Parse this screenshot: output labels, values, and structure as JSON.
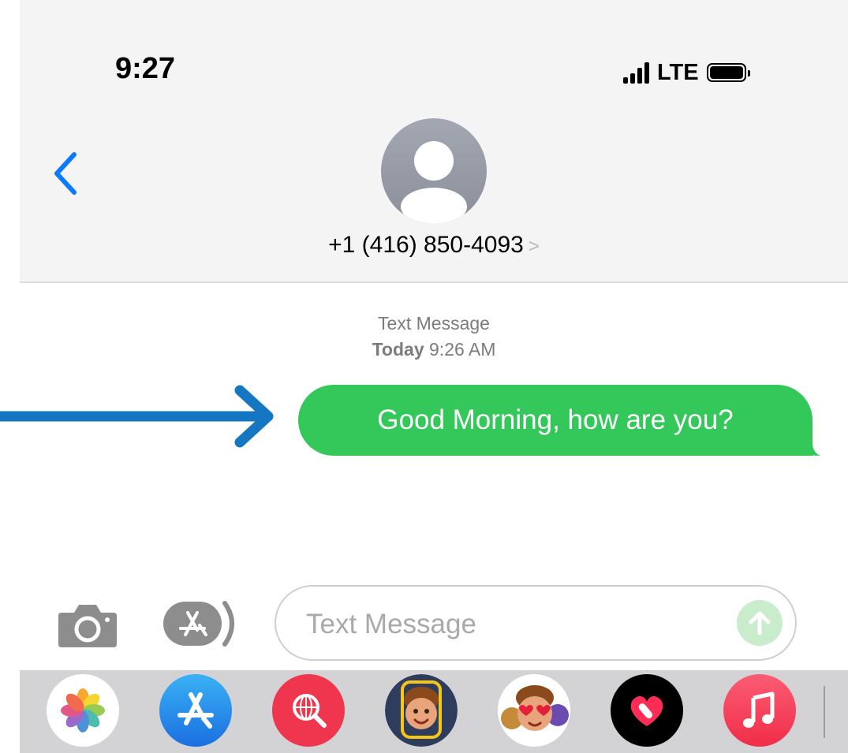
{
  "status_bar": {
    "time": "9:27",
    "network": "LTE"
  },
  "contact": {
    "name": "+1 (416) 850-4093",
    "chevron": ">"
  },
  "thread": {
    "service_label": "Text Message",
    "date_day": "Today",
    "date_time": "9:26 AM"
  },
  "messages": [
    {
      "direction": "outgoing",
      "text": "Good Morning, how are you?",
      "color": "#34c759"
    }
  ],
  "compose": {
    "placeholder": "Text Message",
    "value": ""
  },
  "app_drawer": {
    "apps": [
      {
        "name": "photos-app",
        "icon": "photos-flower-icon"
      },
      {
        "name": "app-store-app",
        "icon": "app-store-icon"
      },
      {
        "name": "images-search-app",
        "icon": "globe-search-icon"
      },
      {
        "name": "memoji-stickers-app",
        "icon": "memoji-icon"
      },
      {
        "name": "animoji-app",
        "icon": "animoji-heart-eyes-icon"
      },
      {
        "name": "digital-touch-app",
        "icon": "heart-touch-icon"
      },
      {
        "name": "music-app",
        "icon": "music-note-icon"
      }
    ]
  },
  "colors": {
    "accent_blue": "#0a7aff",
    "bubble_green": "#34c759",
    "annotation_arrow": "#1577c1"
  }
}
